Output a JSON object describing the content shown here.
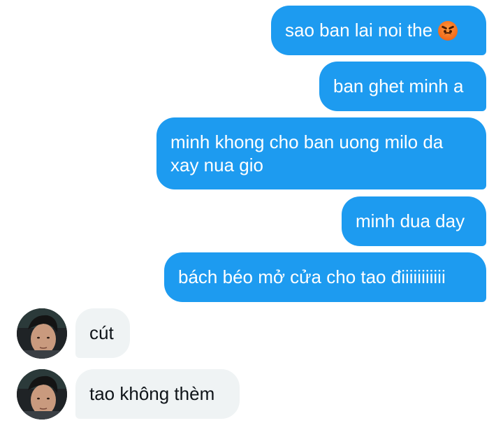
{
  "conversation": {
    "sent_messages": [
      {
        "text": "sao ban lai noi the",
        "emoji": "angry-face-emoji"
      },
      {
        "text": "ban ghet minh a"
      },
      {
        "text": "minh khong cho ban uong milo da xay nua gio"
      },
      {
        "text": "minh dua day"
      },
      {
        "text": "bách béo mở cửa cho tao điiiiiiiiiii"
      }
    ],
    "received_messages": [
      {
        "text": "cút"
      },
      {
        "text": "tao không thèm"
      }
    ]
  },
  "colors": {
    "sent_bubble": "#1d9bf0",
    "received_bubble": "#eff3f4",
    "sent_text": "#ffffff",
    "received_text": "#0f1419"
  }
}
